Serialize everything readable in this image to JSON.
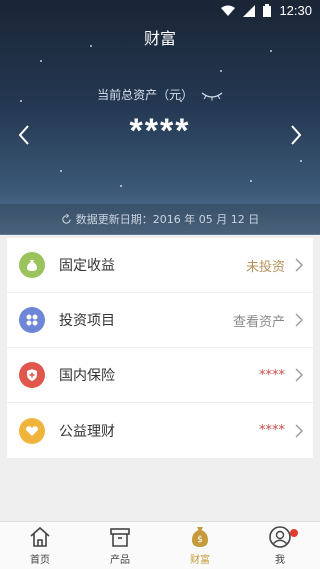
{
  "status_bar": {
    "time": "12:30"
  },
  "header": {
    "title": "财富"
  },
  "assets": {
    "label": "当前总资产（元）",
    "value": "****"
  },
  "update": {
    "text": "数据更新日期：2016 年 05 月 12 日"
  },
  "items": [
    {
      "label": "固定收益",
      "status": "未投资",
      "status_color": "#b8915a",
      "icon": "money-bag-icon",
      "icon_color": "#9bc35b"
    },
    {
      "label": "投资项目",
      "status": "查看资产",
      "status_color": "#888888",
      "icon": "grid-icon",
      "icon_color": "#6d86d8"
    },
    {
      "label": "国内保险",
      "status": "****",
      "status_color": "#c94a4a",
      "icon": "shield-plus-icon",
      "icon_color": "#e0584b"
    },
    {
      "label": "公益理财",
      "status": "****",
      "status_color": "#c94a4a",
      "icon": "heart-icon",
      "icon_color": "#f0b43c"
    }
  ],
  "tabs": [
    {
      "label": "首页",
      "icon": "home-icon",
      "active": false
    },
    {
      "label": "产品",
      "icon": "box-icon",
      "active": false
    },
    {
      "label": "财富",
      "icon": "money-bag-icon",
      "active": true
    },
    {
      "label": "我",
      "icon": "user-icon",
      "active": false
    }
  ],
  "colors": {
    "accent": "#c59a3a",
    "badge": "#e23b2e"
  }
}
